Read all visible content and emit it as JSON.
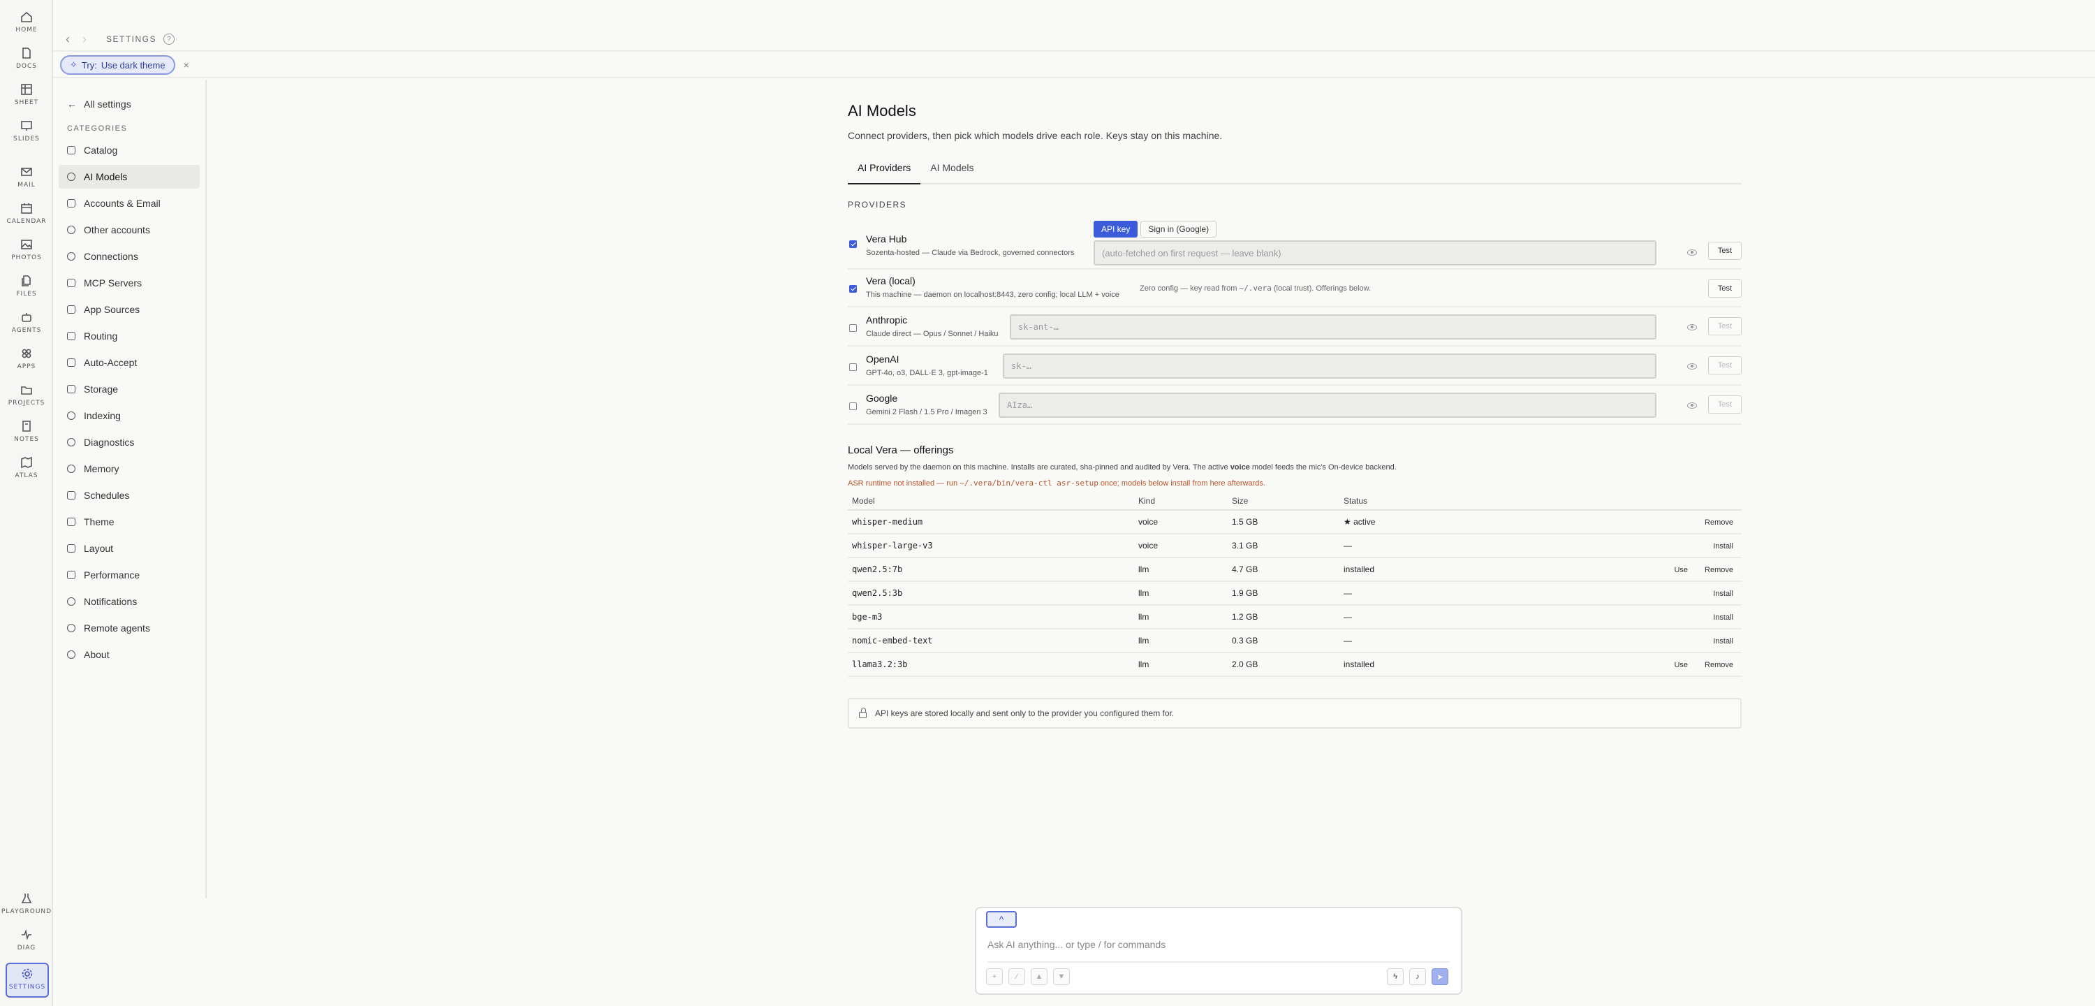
{
  "rail": {
    "top": [
      {
        "label": "HOME",
        "icon": "home-icon"
      },
      {
        "label": "DOCS",
        "icon": "document-icon"
      },
      {
        "label": "SHEET",
        "icon": "sheet-icon"
      },
      {
        "label": "SLIDES",
        "icon": "slides-icon"
      },
      {
        "label": "MAIL",
        "icon": "mail-icon"
      },
      {
        "label": "CALENDAR",
        "icon": "calendar-icon"
      },
      {
        "label": "PHOTOS",
        "icon": "photos-icon"
      },
      {
        "label": "FILES",
        "icon": "files-icon"
      },
      {
        "label": "AGENTS",
        "icon": "agents-icon"
      },
      {
        "label": "APPS",
        "icon": "apps-icon"
      },
      {
        "label": "PROJECTS",
        "icon": "projects-icon"
      },
      {
        "label": "NOTES",
        "icon": "notes-icon"
      },
      {
        "label": "ATLAS",
        "icon": "atlas-icon"
      }
    ],
    "bottom": [
      {
        "label": "PLAYGROUND",
        "icon": "flask-icon"
      },
      {
        "label": "DIAG",
        "icon": "pulse-icon"
      },
      {
        "label": "SETTINGS",
        "icon": "gear-icon"
      }
    ]
  },
  "topbar": {
    "crumb": "SETTINGS",
    "help": "?"
  },
  "hint": {
    "try": "Try:",
    "text": "Use dark theme",
    "close": "×"
  },
  "snav": {
    "back": "All settings",
    "category": "CATEGORIES",
    "items": [
      "Catalog",
      "AI Models",
      "Accounts & Email",
      "Other accounts",
      "Connections",
      "MCP Servers",
      "App Sources",
      "Routing",
      "Auto-Accept",
      "Storage",
      "Indexing",
      "Diagnostics",
      "Memory",
      "Schedules",
      "Theme",
      "Layout",
      "Performance",
      "Notifications",
      "Remote agents",
      "About"
    ],
    "active": "AI Models"
  },
  "main": {
    "title": "AI Models",
    "subtitle": "Connect providers, then pick which models drive each role. Keys stay on this machine.",
    "tabs": [
      "AI Providers",
      "AI Models"
    ],
    "providers_heading": "PROVIDERS",
    "providers": [
      {
        "name": "Vera Hub",
        "desc": "Sozenta-hosted — Claude via Bedrock, governed connectors",
        "checked": true,
        "field": "(auto-fetched on first request — leave blank)",
        "test": "Test",
        "seg": [
          "API key",
          "Sign in (Google)"
        ]
      },
      {
        "name": "Vera (local)",
        "desc": "This machine — daemon on localhost:8443, zero config; local LLM + voice",
        "checked": true,
        "note_pre": "Zero config — key read from ",
        "note_mono": "~/.vera",
        "note_post": " (local trust). Offerings below.",
        "test": "Test"
      },
      {
        "name": "Anthropic",
        "desc": "Claude direct — Opus / Sonnet / Haiku",
        "checked": false,
        "field": "sk-ant-…",
        "test": "Test"
      },
      {
        "name": "OpenAI",
        "desc": "GPT-4o, o3, DALL·E 3, gpt-image-1",
        "checked": false,
        "field": "sk-…",
        "test": "Test"
      },
      {
        "name": "Google",
        "desc": "Gemini 2 Flash / 1.5 Pro / Imagen 3",
        "checked": false,
        "field": "AIza…",
        "test": "Test"
      }
    ],
    "local": {
      "heading": "Local Vera — offerings",
      "desc_pre": "Models served by the daemon on this machine. Installs are curated, sha-pinned and audited by Vera. The active ",
      "desc_bold": "voice",
      "desc_post": " model feeds the mic's On-device backend.",
      "warn_pre": "ASR runtime not installed — run ",
      "warn_mono": "~/.vera/bin/vera-ctl asr-setup",
      "warn_post": " once; models below install from here afterwards.",
      "columns": [
        "Model",
        "Kind",
        "Size",
        "Status"
      ],
      "rows": [
        {
          "model": "whisper-medium",
          "kind": "voice",
          "size": "1.5 GB",
          "status": "★ active",
          "actions": [
            "Remove"
          ]
        },
        {
          "model": "whisper-large-v3",
          "kind": "voice",
          "size": "3.1 GB",
          "status": "—",
          "actions": [
            "Install"
          ]
        },
        {
          "model": "qwen2.5:7b",
          "kind": "llm",
          "size": "4.7 GB",
          "status": "installed",
          "actions": [
            "Use",
            "Remove"
          ]
        },
        {
          "model": "qwen2.5:3b",
          "kind": "llm",
          "size": "1.9 GB",
          "status": "—",
          "actions": [
            "Install"
          ]
        },
        {
          "model": "bge-m3",
          "kind": "llm",
          "size": "1.2 GB",
          "status": "—",
          "actions": [
            "Install"
          ]
        },
        {
          "model": "nomic-embed-text",
          "kind": "llm",
          "size": "0.3 GB",
          "status": "—",
          "actions": [
            "Install"
          ]
        },
        {
          "model": "llama3.2:3b",
          "kind": "llm",
          "size": "2.0 GB",
          "status": "installed",
          "actions": [
            "Use",
            "Remove"
          ]
        }
      ]
    },
    "notice": "API keys are stored locally and sent only to the provider you configured them for."
  },
  "composer": {
    "placeholder": "Ask AI anything... or type / for commands",
    "expand": "^",
    "buttons_left": [
      "plus-icon",
      "wand-icon",
      "thumbs-up-icon",
      "thumbs-down-icon"
    ],
    "buttons_right": [
      "bolt-icon",
      "mic-icon",
      "send-icon"
    ]
  },
  "colors": {
    "accent": "#3b5bdb",
    "warning": "#b8562a"
  }
}
